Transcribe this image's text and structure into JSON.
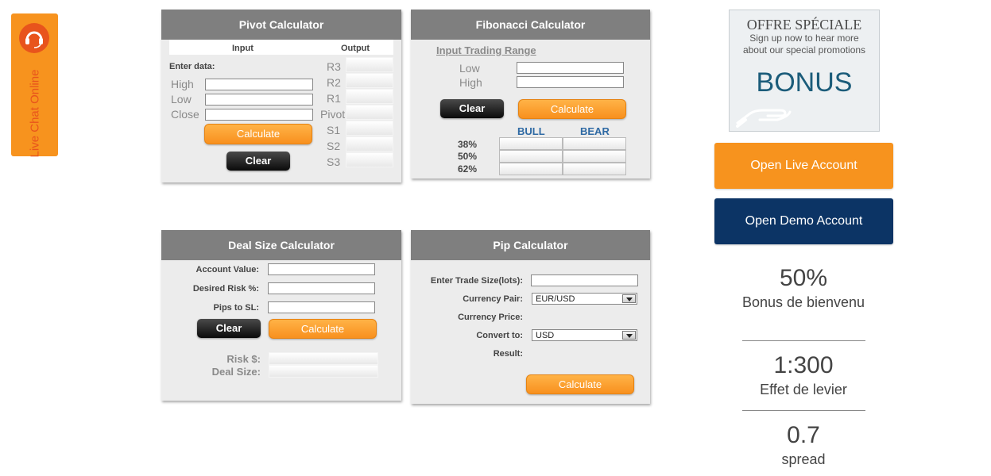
{
  "live_chat": {
    "label": "Live Chat Online"
  },
  "pivot": {
    "title": "Pivot Calculator",
    "input_header": "Input",
    "output_header": "Output",
    "enter_data": "Enter data:",
    "high": "High",
    "low": "Low",
    "close": "Close",
    "calculate": "Calculate",
    "clear": "Clear",
    "outputs": [
      "R3",
      "R2",
      "R1",
      "Pivot",
      "S1",
      "S2",
      "S3"
    ]
  },
  "fibonacci": {
    "title": "Fibonacci Calculator",
    "range_label": "Input Trading Range",
    "low": "Low",
    "high": "High",
    "clear": "Clear",
    "calculate": "Calculate",
    "bull": "BULL",
    "bear": "BEAR",
    "levels": [
      "38%",
      "50%",
      "62%"
    ]
  },
  "deal_size": {
    "title": "Deal Size Calculator",
    "account_value": "Account Value:",
    "desired_risk": "Desired Risk %:",
    "pips_to_sl": "Pips to SL:",
    "clear": "Clear",
    "calculate": "Calculate",
    "risk": "Risk $:",
    "deal_size": "Deal Size:"
  },
  "pip": {
    "title": "Pip Calculator",
    "trade_size": "Enter Trade Size(lots):",
    "currency_pair": "Currency Pair:",
    "currency_pair_value": "EUR/USD",
    "currency_price": "Currency Price:",
    "convert_to": "Convert to:",
    "convert_to_value": "USD",
    "result": "Result:",
    "calculate": "Calculate"
  },
  "promo": {
    "heading": "OFFRE SPÉCIALE",
    "text": "Sign up now to hear more about our special promotions",
    "bonus": "BONUS"
  },
  "buttons": {
    "live": "Open Live Account",
    "demo": "Open Demo Account",
    "live_color": "#f7931e",
    "demo_color": "#0c3465"
  },
  "stats": [
    {
      "value": "50%",
      "label": "Bonus de bienvenu"
    },
    {
      "value": "1:300",
      "label": "Effet de levier"
    },
    {
      "value": "0.7",
      "label": "spread"
    }
  ]
}
